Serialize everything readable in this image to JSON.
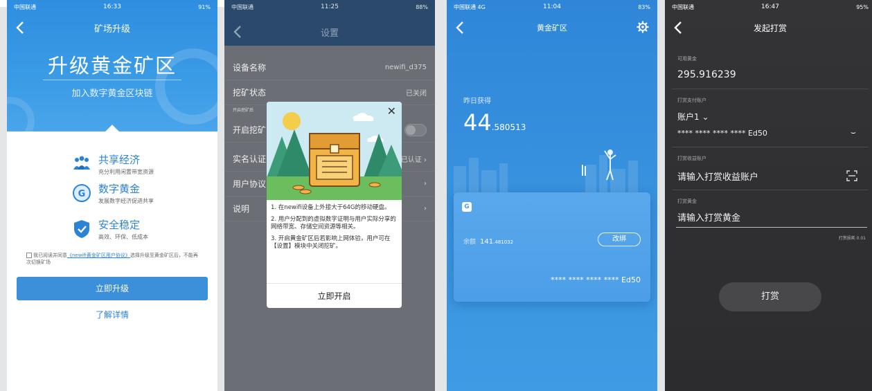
{
  "p1": {
    "status": {
      "carrier": "中国联通",
      "time": "16:33",
      "battery": "91%"
    },
    "nav_title": "矿场升级",
    "hero_title": "升级黄金矿区",
    "hero_subtitle": "加入数字黄金区块链",
    "features": [
      {
        "title": "共享经济",
        "desc": "充分利用闲置带宽资源",
        "icon": "people-icon"
      },
      {
        "title": "数字黄金",
        "desc": "发展数字经济促进共享",
        "icon": "g-coin-icon"
      },
      {
        "title": "安全稳定",
        "desc": "高效、环保、低成本",
        "icon": "shield-icon"
      }
    ],
    "agree_prefix": "我已阅读并同意",
    "agree_link": "《newifi黄金矿区用户协议》",
    "agree_suffix": "选择升级至黄金矿区后，不能再次切换矿场",
    "upgrade_btn": "立即升级",
    "learn_more": "了解详情",
    "accent": "#3c8fd9"
  },
  "p2": {
    "status": {
      "carrier": "中国联通",
      "time": "11:25",
      "battery": "88%"
    },
    "nav_title": "设置",
    "rows": [
      {
        "label": "设备名称",
        "value": "newifi_d375"
      },
      {
        "label": "挖矿状态",
        "value": "已关闭"
      }
    ],
    "small_label": "开启挖矿后",
    "row_mining": "开启挖矿",
    "row_realname": "实名认证",
    "row_realname_value": "已认证",
    "row_agreement": "用户协议",
    "row_help": "说明",
    "modal": {
      "p1": "1. 在newifi设备上外接大于64G的移动硬盘。",
      "p2": "2. 用户分配到的虚拟数字证明与用户实际分享的网络带宽、存储空间资源等相关。",
      "p3": "3. 开启黄金矿区后若影响上网体验，用户可在【设置】模块中关闭挖矿。",
      "button": "立即开启"
    }
  },
  "p3": {
    "status": {
      "carrier": "中国联通",
      "network": "4G",
      "time": "11:04",
      "battery": "83%"
    },
    "nav_title": "黄金矿区",
    "yesterday_label": "昨日获得",
    "yesterday_int": "44",
    "yesterday_dec": ".580513",
    "card": {
      "balance_label": "余额",
      "balance_int": "141",
      "balance_dec": ".481032",
      "change_btn": "改绑",
      "account": "**** **** **** **** Ed50"
    }
  },
  "p4": {
    "status": {
      "carrier": "中国联通",
      "time": "16:47",
      "battery": "95%"
    },
    "nav_title": "发起打赏",
    "available_label": "可用黄金",
    "available_value": "295.916239",
    "pay_account_label": "打赏支付账户",
    "pay_account_name": "账户1",
    "pay_account_number": "**** **** **** **** Ed50",
    "receive_label": "打赏收益账户",
    "receive_placeholder": "请输入打赏收益账户",
    "amount_label": "打赏黄金",
    "amount_placeholder": "请输入打赏黄金",
    "fee": "打赏损耗 0.01",
    "tip_btn": "打赏"
  }
}
